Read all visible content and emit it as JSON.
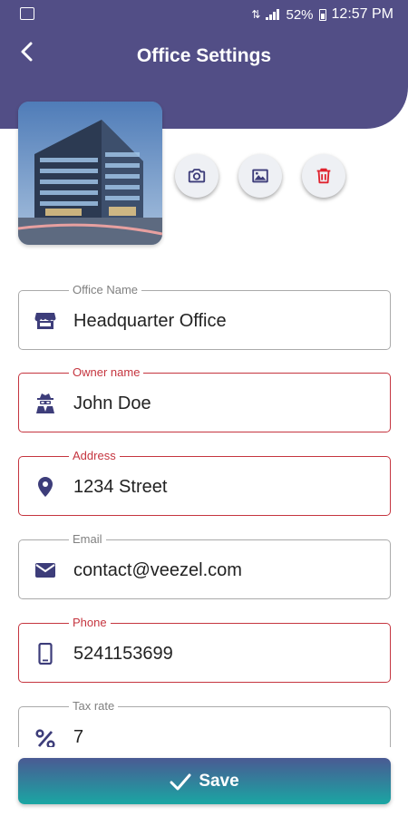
{
  "status_bar": {
    "battery": "52%",
    "time": "12:57 PM"
  },
  "header": {
    "title": "Office Settings"
  },
  "photo_actions": {
    "camera": "camera-icon",
    "gallery": "image-icon",
    "delete": "trash-icon"
  },
  "fields": [
    {
      "label": "Office Name",
      "value": "Headquarter Office",
      "icon": "store-icon",
      "error": false
    },
    {
      "label": "Owner name",
      "value": "John Doe",
      "icon": "user-secret-icon",
      "error": true
    },
    {
      "label": "Address",
      "value": "1234 Street",
      "icon": "map-marker-icon",
      "error": true
    },
    {
      "label": "Email",
      "value": "contact@veezel.com",
      "icon": "envelope-icon",
      "error": false
    },
    {
      "label": "Phone",
      "value": "5241153699",
      "icon": "mobile-icon",
      "error": true
    },
    {
      "label": "Tax rate",
      "value": "7",
      "icon": "percent-icon",
      "error": false
    }
  ],
  "save_button": {
    "label": "Save"
  },
  "colors": {
    "header": "#524e86",
    "accent_icon": "#3d3d7a",
    "error": "#c5353f",
    "delete": "#e0232e",
    "button_top": "#4a5a93",
    "button_bottom": "#1aa6a3"
  }
}
